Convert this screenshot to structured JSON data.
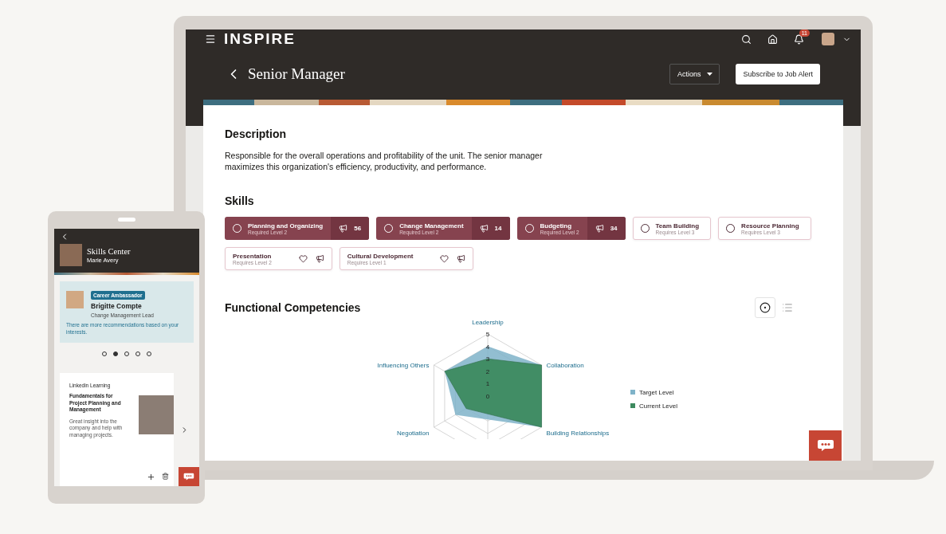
{
  "laptop": {
    "app_name": "INSPIRE",
    "notification_count": "11",
    "page_title": "Senior Manager",
    "actions_button": "Actions",
    "subscribe_button": "Subscribe to Job Alert",
    "description": {
      "heading": "Description",
      "text": "Responsible for the overall operations and profitability of the unit. The senior manager maximizes this organization's efficiency, productivity, and performance."
    },
    "skills": {
      "heading": "Skills",
      "items": [
        {
          "kind": "required",
          "name": "Planning and Organizing",
          "level": "Required Level 2",
          "count": "56"
        },
        {
          "kind": "required",
          "name": "Change Management",
          "level": "Required Level 2",
          "count": "14"
        },
        {
          "kind": "required",
          "name": "Budgeting",
          "level": "Required Level 2",
          "count": "34"
        },
        {
          "kind": "suggested",
          "name": "Team Building",
          "level": "Requires Level 3"
        },
        {
          "kind": "suggested",
          "name": "Resource Planning",
          "level": "Requires Level 3"
        },
        {
          "kind": "interest",
          "name": "Presentation",
          "level": "Requires Level 2"
        },
        {
          "kind": "interest",
          "name": "Cultural Development",
          "level": "Requires Level 1"
        }
      ]
    },
    "competencies": {
      "heading": "Functional Competencies",
      "views": [
        {
          "kind": "chart",
          "selected": true
        },
        {
          "kind": "list",
          "selected": false
        }
      ],
      "radar": {
        "axis_labels": [
          "Leadership",
          "Influencing Others",
          "Collaboration",
          "Negotiation",
          "Building Relationships"
        ],
        "ticks": [
          "5",
          "4",
          "3",
          "2",
          "1",
          "0"
        ],
        "legend": [
          {
            "name": "Target Level",
            "color": "#7fb3c9"
          },
          {
            "name": "Current Level",
            "color": "#3d8a5f"
          }
        ]
      }
    }
  },
  "tablet": {
    "title": "Skills Center",
    "user": "Marie Avery",
    "badge": "Career Ambassador",
    "person": "Brigitte Compte",
    "role": "Change Management Lead",
    "note": "There are more recommendations based on your interests.",
    "pager": [
      {
        "selected": false
      },
      {
        "selected": true
      },
      {
        "selected": false
      },
      {
        "selected": false
      },
      {
        "selected": false
      }
    ],
    "course": {
      "provider": "Linkedin Learning",
      "title": "Fundamentals for Project Planning and Management",
      "text": "Great insight into the company and help with managing projects."
    }
  }
}
